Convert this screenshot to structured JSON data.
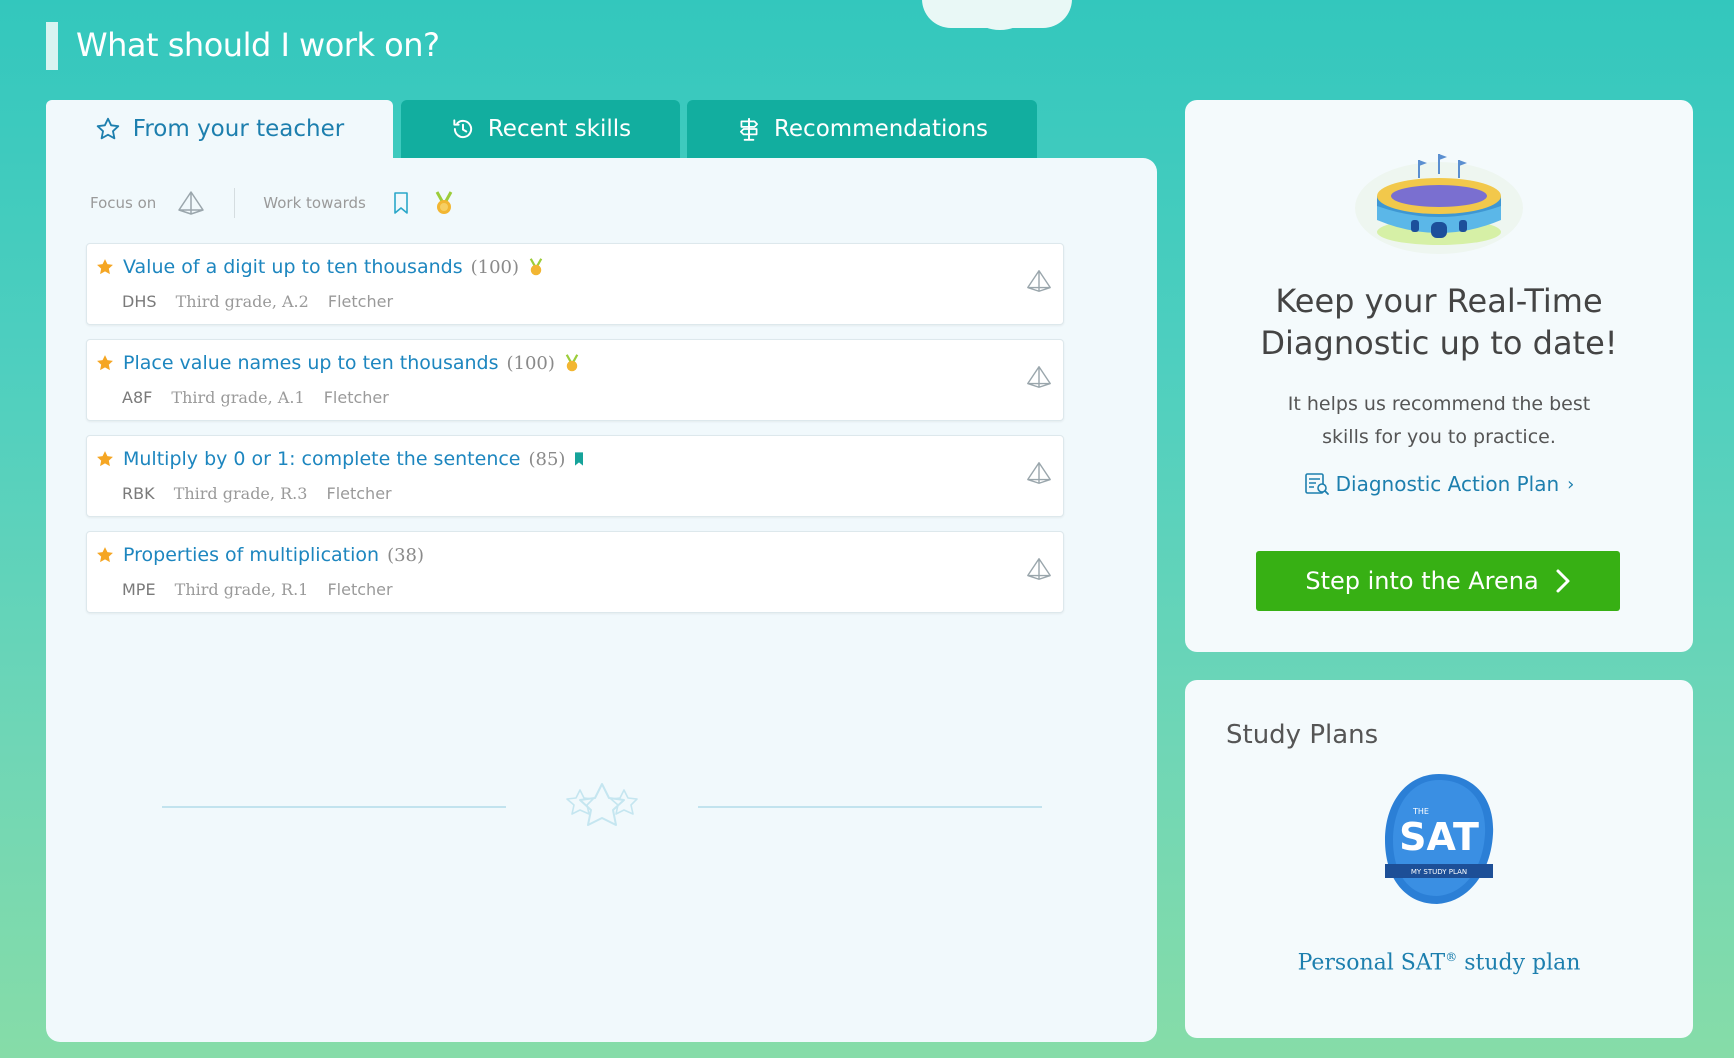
{
  "heading": "What should I work on?",
  "tabs": [
    {
      "label": "From your teacher",
      "icon": "star-outline-icon",
      "active": true
    },
    {
      "label": "Recent skills",
      "icon": "history-icon",
      "active": false
    },
    {
      "label": "Recommendations",
      "icon": "signpost-icon",
      "active": false
    }
  ],
  "filters": {
    "focus_label": "Focus on",
    "work_label": "Work towards"
  },
  "skills": [
    {
      "name": "Value of a digit up to ten thousands",
      "score": "(100)",
      "badge": "medal",
      "code": "DHS",
      "grade": "Third grade, A.2",
      "teacher": "Fletcher"
    },
    {
      "name": "Place value names up to ten thousands",
      "score": "(100)",
      "badge": "medal",
      "code": "A8F",
      "grade": "Third grade, A.1",
      "teacher": "Fletcher"
    },
    {
      "name": "Multiply by 0 or 1: complete the sentence",
      "score": "(85)",
      "badge": "bookmark",
      "code": "RBK",
      "grade": "Third grade, R.3",
      "teacher": "Fletcher"
    },
    {
      "name": "Properties of multiplication",
      "score": "(38)",
      "badge": "",
      "code": "MPE",
      "grade": "Third grade, R.1",
      "teacher": "Fletcher"
    }
  ],
  "diagnostic": {
    "title_line1": "Keep your Real-Time",
    "title_line2": "Diagnostic up to date!",
    "sub_line1": "It helps us recommend the best",
    "sub_line2": "skills for you to practice.",
    "link": "Diagnostic Action Plan",
    "link_chevron": "›",
    "button": "Step into the Arena"
  },
  "study_plans": {
    "title": "Study Plans",
    "badge_small": "THE",
    "badge_big": "SAT",
    "badge_ribbon": "MY STUDY PLAN",
    "link_pre": "Personal SAT",
    "link_sup": "®",
    "link_post": " study plan"
  },
  "colors": {
    "accent_blue": "#1d86bf",
    "tab_teal": "#12ae9f",
    "arena_green": "#37b014",
    "star_gold": "#f5a623"
  }
}
